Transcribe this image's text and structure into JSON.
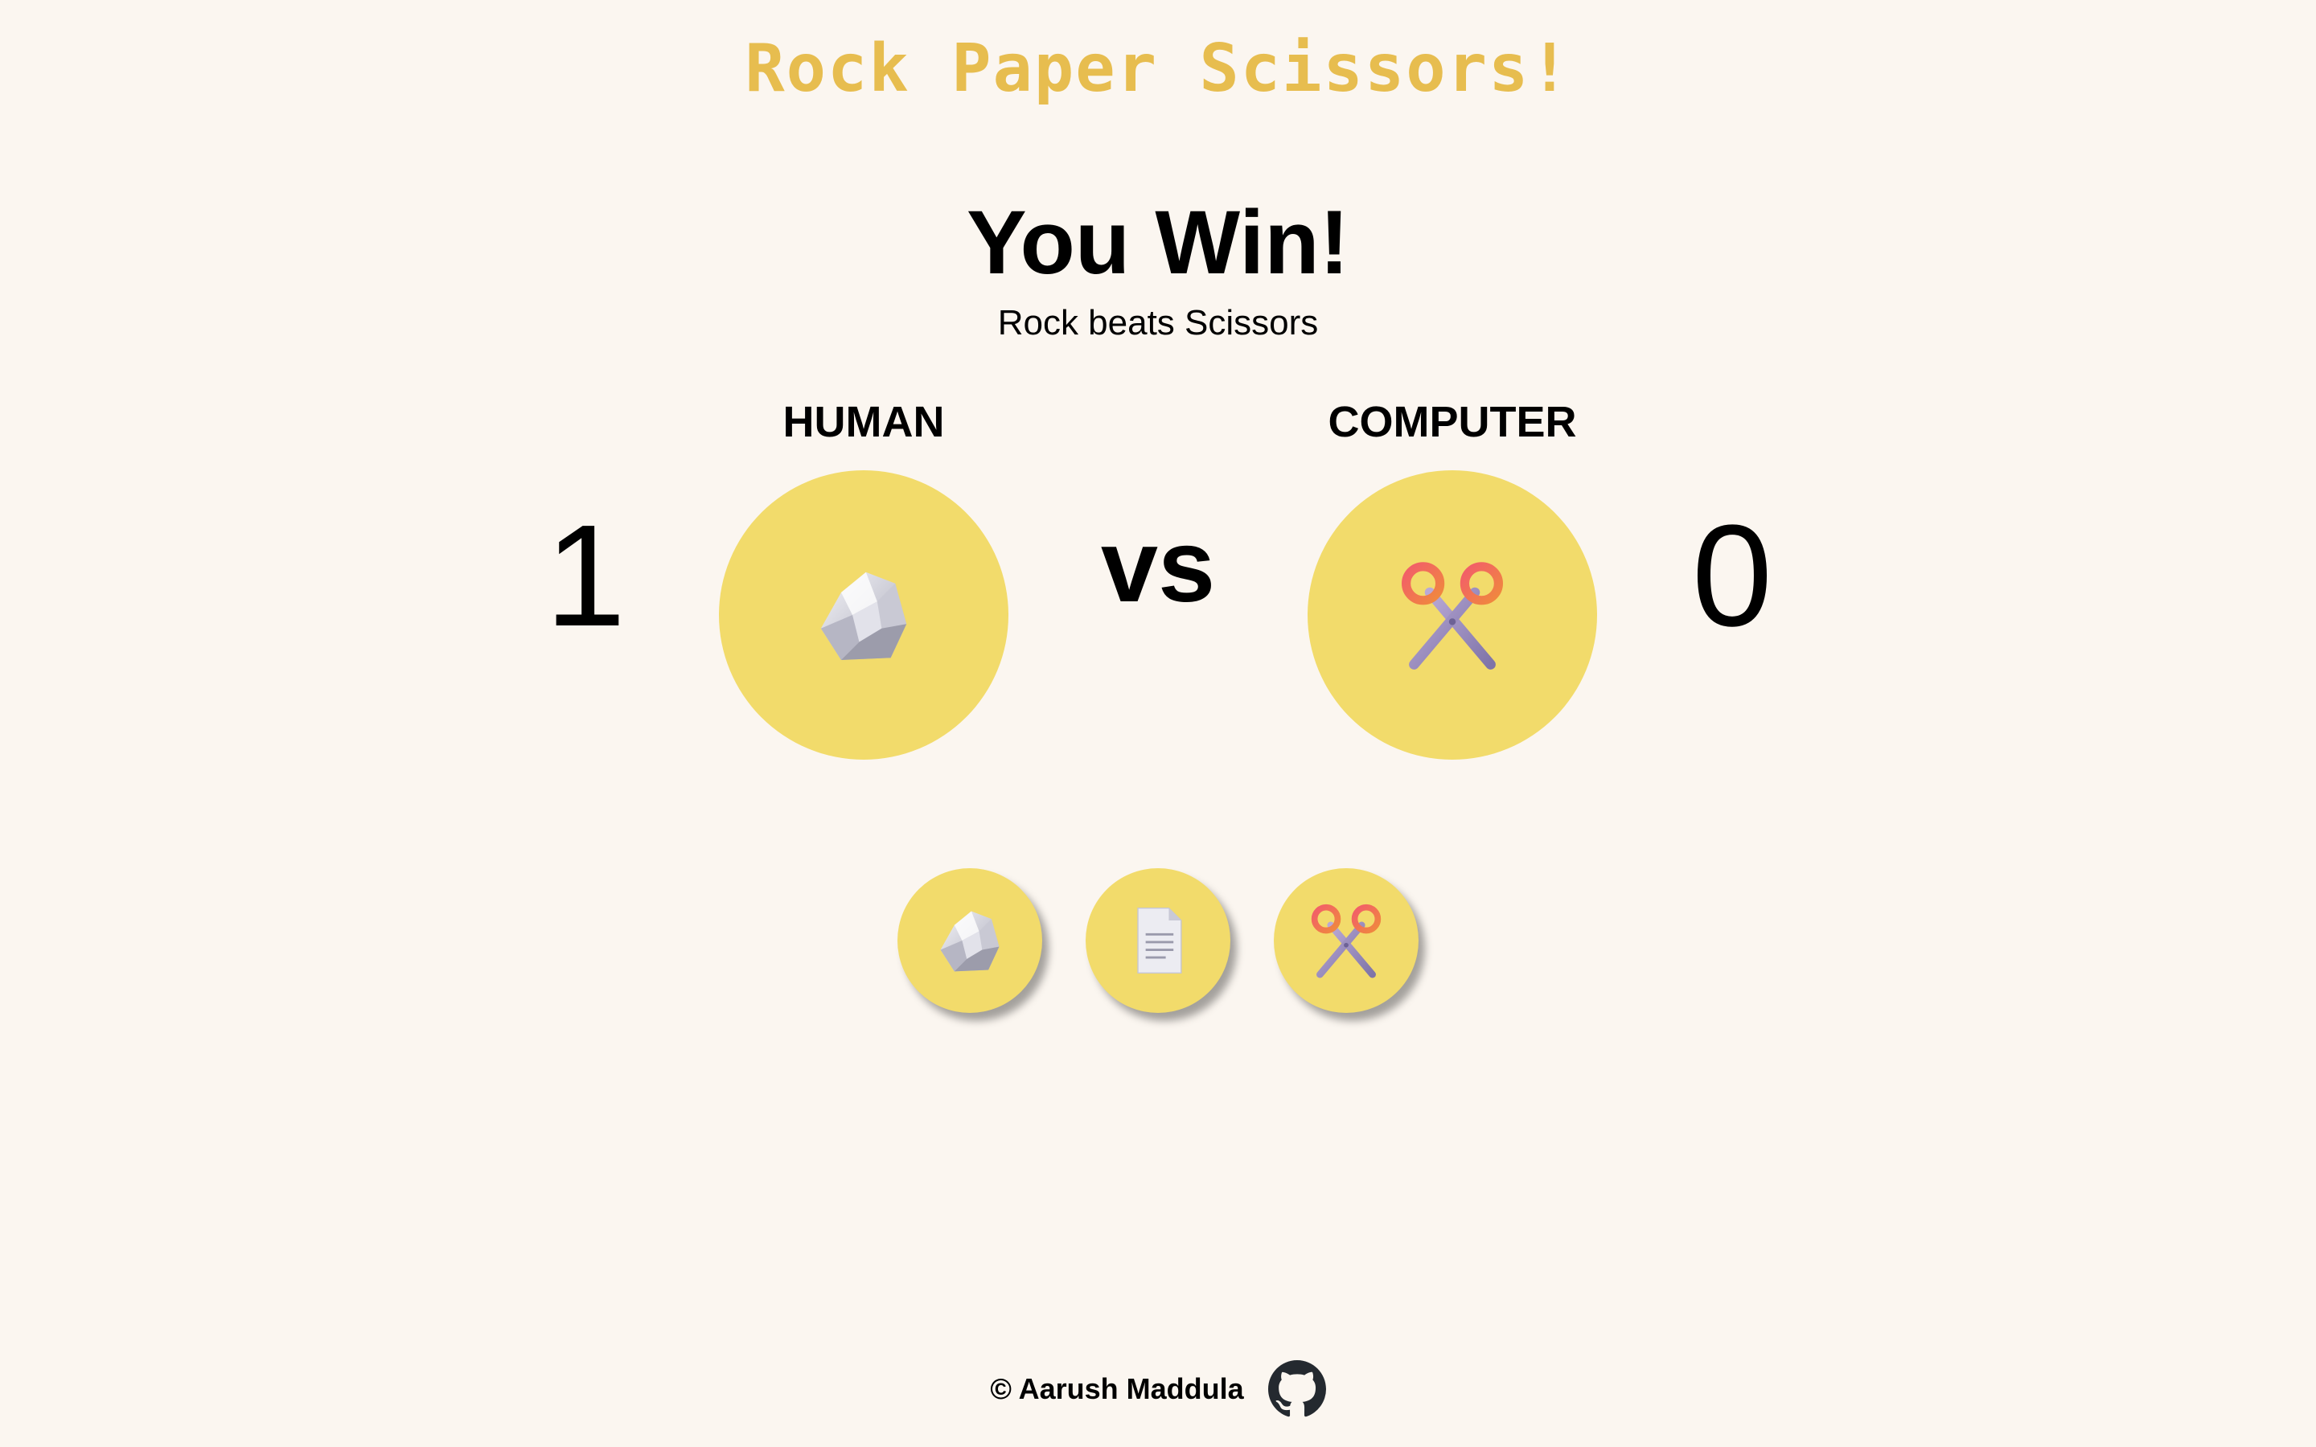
{
  "header": {
    "title": "Rock Paper Scissors!"
  },
  "result": {
    "headline": "You Win!",
    "detail": "Rock beats Scissors"
  },
  "players": {
    "human": {
      "label": "HUMAN",
      "score": "1",
      "choice_icon": "rock-icon"
    },
    "computer": {
      "label": "COMPUTER",
      "score": "0",
      "choice_icon": "scissors-icon"
    }
  },
  "vs_text": "vs",
  "choices": [
    {
      "name": "rock",
      "icon": "rock-icon"
    },
    {
      "name": "paper",
      "icon": "paper-icon"
    },
    {
      "name": "scissors",
      "icon": "scissors-icon"
    }
  ],
  "footer": {
    "credit": "© Aarush Maddula",
    "link_icon": "github-icon"
  },
  "colors": {
    "background": "#fbf6f0",
    "title": "#e7bd4f",
    "circle": "#f2db6b"
  }
}
